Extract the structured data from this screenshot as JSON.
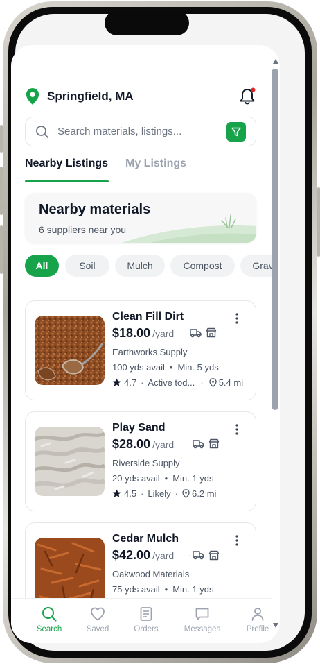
{
  "location": {
    "city": "Springfield, MA"
  },
  "search": {
    "placeholder": "Search materials, listings..."
  },
  "tabs": [
    {
      "label": "Nearby Listings",
      "active": true
    },
    {
      "label": "My Listings",
      "active": false
    }
  ],
  "hero": {
    "title": "Nearby materials",
    "subtitle": "6 suppliers near you"
  },
  "chips": [
    "All",
    "Soil",
    "Mulch",
    "Compost",
    "Gravel"
  ],
  "listings": [
    {
      "title": "Clean Fill Dirt",
      "price": "$18.00",
      "unit": "/yard",
      "supplier": "Earthworks Supply",
      "avail": "100 yds avail",
      "min": "Min. 5 yds",
      "rating": "4.7",
      "status": "Active tod...",
      "distance": "5.4 mi"
    },
    {
      "title": "Play Sand",
      "price": "$28.00",
      "unit": "/yard",
      "supplier": "Riverside Supply",
      "avail": "20 yds avail",
      "min": "Min. 1 yds",
      "rating": "4.5",
      "status": "Likely",
      "distance": "6.2 mi"
    },
    {
      "title": "Cedar Mulch",
      "price": "$42.00",
      "unit": "/yard",
      "supplier": "Oakwood Materials",
      "avail": "75 yds avail",
      "min": "Min. 1 yds",
      "delivery_prefix": "-"
    }
  ],
  "nav": [
    {
      "label": "Search",
      "icon": "search-icon",
      "active": true
    },
    {
      "label": "Saved",
      "icon": "heart-icon",
      "active": false
    },
    {
      "label": "Orders",
      "icon": "orders-icon",
      "active": false
    },
    {
      "label": "Messages",
      "icon": "message-icon",
      "active": false
    },
    {
      "label": "Profile",
      "icon": "profile-icon",
      "active": false
    }
  ],
  "colors": {
    "accent": "#16a34a",
    "notification_dot": "#dc2626"
  }
}
